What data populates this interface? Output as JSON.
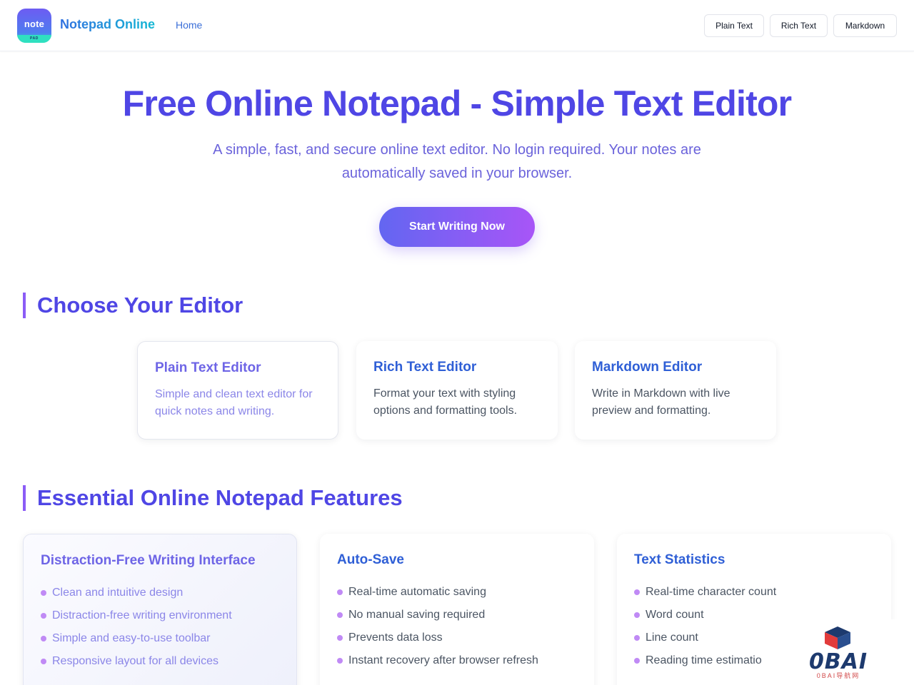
{
  "header": {
    "logo_main": "note",
    "logo_sub": "PAD",
    "brand": "Notepad Online",
    "nav_home": "Home",
    "buttons": [
      "Plain Text",
      "Rich Text",
      "Markdown"
    ]
  },
  "hero": {
    "title": "Free Online Notepad - Simple Text Editor",
    "subtitle": "A simple, fast, and secure online text editor. No login required. Your notes are automatically saved in your browser.",
    "cta": "Start Writing Now"
  },
  "editors": {
    "title": "Choose Your Editor",
    "cards": [
      {
        "title": "Plain Text Editor",
        "desc": "Simple and clean text editor for quick notes and writing."
      },
      {
        "title": "Rich Text Editor",
        "desc": "Format your text with styling options and formatting tools."
      },
      {
        "title": "Markdown Editor",
        "desc": "Write in Markdown with live preview and formatting."
      }
    ]
  },
  "features": {
    "title": "Essential Online Notepad Features",
    "cards": [
      {
        "title": "Distraction-Free Writing Interface",
        "items": [
          "Clean and intuitive design",
          "Distraction-free writing environment",
          "Simple and easy-to-use toolbar",
          "Responsive layout for all devices"
        ]
      },
      {
        "title": "Auto-Save",
        "items": [
          "Real-time automatic saving",
          "No manual saving required",
          "Prevents data loss",
          "Instant recovery after browser refresh"
        ]
      },
      {
        "title": "Text Statistics",
        "items": [
          "Real-time character count",
          "Word count",
          "Line count",
          "Reading time estimatio"
        ]
      }
    ]
  },
  "watermark": {
    "text": "0BAI",
    "sub": "0BAI导航网"
  },
  "colors": {
    "accent": "#4f46e5",
    "gradient_start": "#6366f1",
    "gradient_end": "#a855f7",
    "link": "#2f5fd6"
  }
}
